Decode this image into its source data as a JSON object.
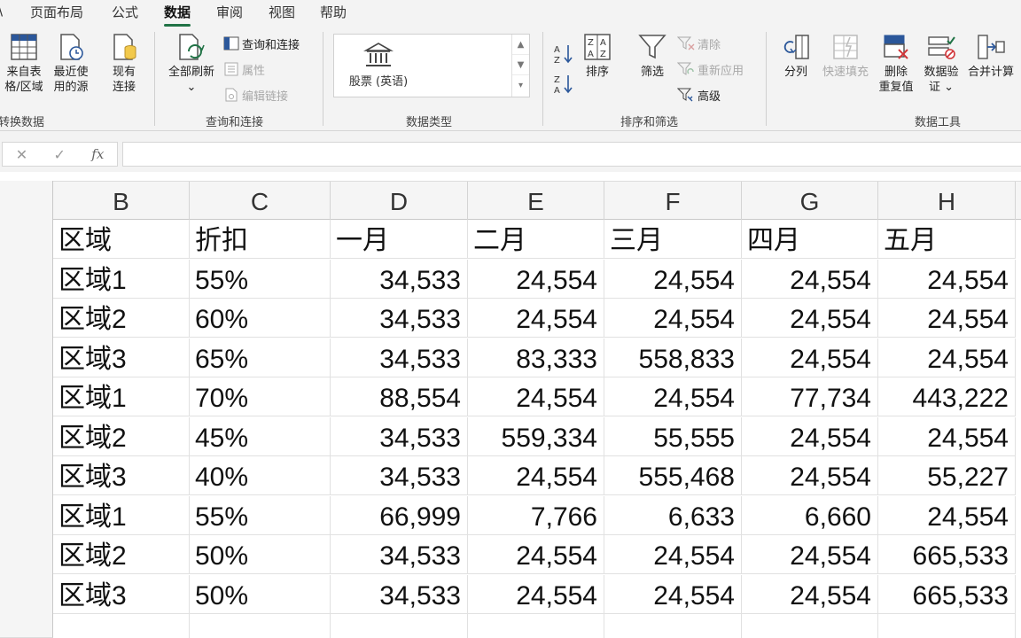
{
  "menu": {
    "tabs": [
      {
        "label": "\\",
        "active": false
      },
      {
        "label": "页面布局",
        "active": false
      },
      {
        "label": "公式",
        "active": false
      },
      {
        "label": "数据",
        "active": true
      },
      {
        "label": "审阅",
        "active": false
      },
      {
        "label": "视图",
        "active": false
      },
      {
        "label": "帮助",
        "active": false
      }
    ]
  },
  "ribbon": {
    "get_transform": {
      "from_table_l1": "来自表",
      "from_table_l2": "格/区域",
      "recent_l1": "最近使",
      "recent_l2": "用的源",
      "existing_l1": "现有",
      "existing_l2": "连接",
      "group_label": "转换数据"
    },
    "queries": {
      "refresh_all": "全部刷新",
      "refresh_chevron": "⌄",
      "queries_connections": "查询和连接",
      "properties": "属性",
      "edit_links": "编辑链接",
      "group_label": "查询和连接"
    },
    "data_types": {
      "stocks": "股票 (英语)",
      "group_label": "数据类型"
    },
    "sort_filter": {
      "sort": "排序",
      "filter": "筛选",
      "clear": "清除",
      "reapply": "重新应用",
      "advanced": "高级",
      "group_label": "排序和筛选"
    },
    "data_tools": {
      "text_to_columns": "分列",
      "flash_fill": "快速填充",
      "remove_dup_l1": "删除",
      "remove_dup_l2": "重复值",
      "validation_l1": "数据验",
      "validation_l2": "证 ⌄",
      "consolidate": "合并计算",
      "group_label": "数据工具"
    }
  },
  "formula_bar": {
    "cancel": "✕",
    "enter": "✓",
    "fx": "fx",
    "value": ""
  },
  "grid": {
    "columns": [
      "B",
      "C",
      "D",
      "E",
      "F",
      "G",
      "H"
    ],
    "header": [
      "区域",
      "折扣",
      "一月",
      "二月",
      "三月",
      "四月",
      "五月"
    ],
    "rows": [
      [
        "区域1",
        "55%",
        "34,533",
        "24,554",
        "24,554",
        "24,554",
        "24,554"
      ],
      [
        "区域2",
        "60%",
        "34,533",
        "24,554",
        "24,554",
        "24,554",
        "24,554"
      ],
      [
        "区域3",
        "65%",
        "34,533",
        "83,333",
        "558,833",
        "24,554",
        "24,554"
      ],
      [
        "区域1",
        "70%",
        "88,554",
        "24,554",
        "24,554",
        "77,734",
        "443,222"
      ],
      [
        "区域2",
        "45%",
        "34,533",
        "559,334",
        "55,555",
        "24,554",
        "24,554"
      ],
      [
        "区域3",
        "40%",
        "34,533",
        "24,554",
        "555,468",
        "24,554",
        "55,227"
      ],
      [
        "区域1",
        "55%",
        "66,999",
        "7,766",
        "6,633",
        "6,660",
        "24,554"
      ],
      [
        "区域2",
        "50%",
        "34,533",
        "24,554",
        "24,554",
        "24,554",
        "665,533"
      ],
      [
        "区域3",
        "50%",
        "34,533",
        "24,554",
        "24,554",
        "24,554",
        "665,533"
      ]
    ]
  },
  "colors": {
    "accent": "#217346",
    "ribbon_bg": "#f3f3f3",
    "grid_line": "#e1e1e1"
  }
}
